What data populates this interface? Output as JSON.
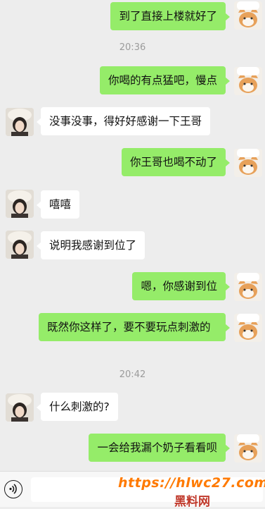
{
  "messages": [
    {
      "side": "me",
      "text": "到了直接上楼就好了"
    },
    {
      "timestamp": "20:36"
    },
    {
      "side": "me",
      "text": "你喝的有点猛吧，慢点"
    },
    {
      "side": "them",
      "text": "没事没事，得好好感谢一下王哥"
    },
    {
      "side": "me",
      "text": "你王哥也喝不动了"
    },
    {
      "side": "them",
      "text": "嘻嘻"
    },
    {
      "side": "them",
      "text": "说明我感谢到位了"
    },
    {
      "side": "me",
      "text": "嗯，你感谢到位"
    },
    {
      "side": "me",
      "text": "既然你这样了，要不要玩点刺激的"
    },
    {
      "timestamp": "20:42"
    },
    {
      "side": "them",
      "text": "什么刺激的?"
    },
    {
      "side": "me",
      "text": "一会给我漏个奶子看看呗"
    }
  ],
  "watermark": {
    "url": "https://hlwc27.com",
    "site": "黑料网"
  },
  "colors": {
    "my_bubble": "#95ec69",
    "their_bubble": "#ffffff",
    "background": "#ededed"
  }
}
